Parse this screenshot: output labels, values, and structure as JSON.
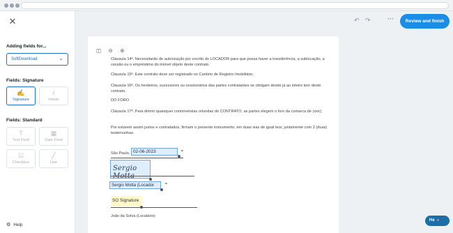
{
  "sidebar": {
    "adding_fields_label": "Adding fields for...",
    "signer_select_value": "SoftDownload",
    "signature_section_label": "Fields: Signature",
    "signature_tiles": [
      {
        "label": "Signature",
        "active": true
      },
      {
        "label": "Initials",
        "active": false
      }
    ],
    "standard_section_label": "Fields: Standard",
    "standard_tiles": [
      {
        "label": "Text Field"
      },
      {
        "label": "Date Field"
      },
      {
        "label": "Checkbox"
      },
      {
        "label": "Line"
      }
    ],
    "help_label": "Help"
  },
  "toolbar": {
    "review_label": "Review and finish",
    "undo_icon": "undo-icon",
    "redo_icon": "redo-icon",
    "more_icon": "more-icon"
  },
  "document": {
    "clause_14_partial": "Cláusula 14ª. Necessitarão de autorização por escrito do LOCADOR para que possa haver a transferência, a sublocação, a cessão ou o empréstimo do imóvel objeto deste contrato.",
    "clause_15": "Cláusula 15ª. Este contrato deve ser registrado no Cartório de Registro Imobiliário.",
    "clause_16": "Cláusula 16ª. Os herdeiros, sucessores ou cessionários das partes contratantes se obrigam desde já ao inteiro teor deste contrato.",
    "heading_foro": "DO FORO",
    "clause_17": "Cláusula 17ª. Para dirimir quaisquer controvérsias oriundas do CONTRATO, as partes elegem o foro da comarca de (xxx);",
    "closing": "Por estarem assim justos e contratados, firmam o presente instrumento, em duas vias de igual teor, juntamente com 2 (duas) testemunhas.",
    "city_prefix": "São Paulo,",
    "date_value": "02-06-2023",
    "signature_text": "Sergio Motta",
    "signer_name_value": "Sergio Motta (Locador",
    "initials_placeholder": "SO Signature",
    "lessee_line": "João da Solva (Locatário)"
  },
  "chat": {
    "label": "He"
  }
}
